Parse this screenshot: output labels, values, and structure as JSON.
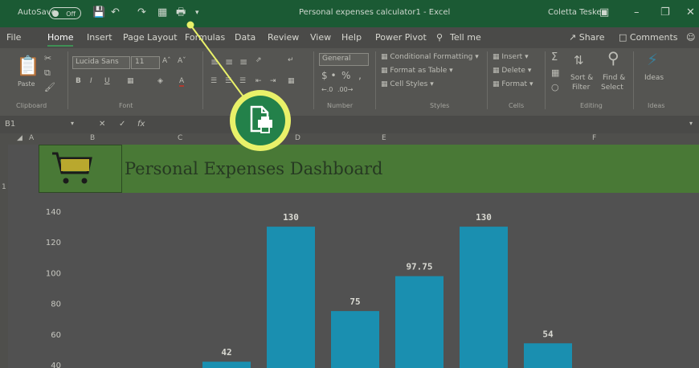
{
  "titlebar": {
    "autosave_label": "AutoSave",
    "autosave_state": "Off",
    "doc_title": "Personal expenses calculator1 - Excel",
    "user_name": "Coletta Teske"
  },
  "menu": {
    "tabs": [
      "File",
      "Home",
      "Insert",
      "Page Layout",
      "Formulas",
      "Data",
      "Review",
      "View",
      "Help",
      "Power Pivot",
      "Tell me"
    ],
    "share": "Share",
    "comments": "Comments"
  },
  "ribbon": {
    "paste": "Paste",
    "font_name": "Lucida Sans",
    "font_size": "11",
    "number_format": "General",
    "conditional_formatting": "Conditional Formatting",
    "format_as_table": "Format as Table",
    "cell_styles": "Cell Styles",
    "insert": "Insert",
    "delete": "Delete",
    "format": "Format",
    "sort_filter_1": "Sort &",
    "sort_filter_2": "Filter",
    "find_select_1": "Find &",
    "find_select_2": "Select",
    "ideas": "Ideas",
    "groups": {
      "clipboard": "Clipboard",
      "font": "Font",
      "number": "Number",
      "styles": "Styles",
      "cells": "Cells",
      "editing": "Editing",
      "ideas": "Ideas"
    }
  },
  "formula_bar": {
    "name_box": "B1",
    "fx": "fx",
    "content": ""
  },
  "columns": [
    "A",
    "B",
    "C",
    "D",
    "E",
    "F"
  ],
  "row_header": "1",
  "sheet": {
    "dashboard_title": "Personal Expenses Dashboard"
  },
  "colors": {
    "excel_green": "#217346",
    "callout_ring": "#e9f169",
    "bar": "#1a8fb0",
    "banner": "#497936"
  },
  "callout_icon": "print-preview-icon",
  "chart_data": {
    "type": "bar",
    "yticks": [
      40,
      60,
      80,
      100,
      120,
      140
    ],
    "ylim": [
      40,
      140
    ],
    "values": [
      42,
      130,
      75,
      97.75,
      130,
      54
    ],
    "labels": [
      "42",
      "130",
      "75",
      "97.75",
      "130",
      "54"
    ]
  }
}
